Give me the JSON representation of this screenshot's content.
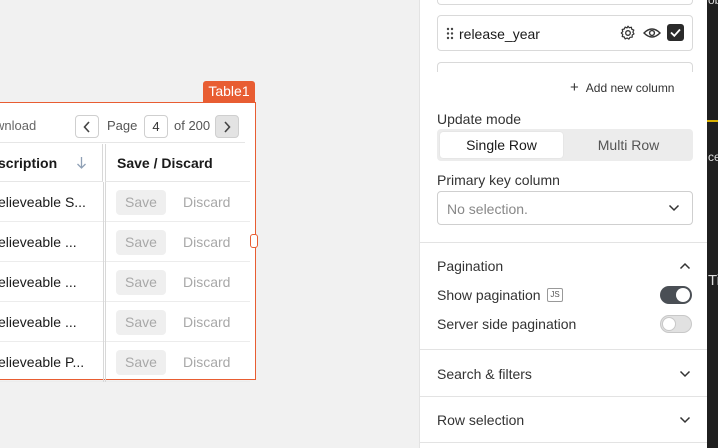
{
  "canvas": {
    "widget_name": "Table1",
    "toolbar": {
      "download_label": "wnload",
      "page_label": "Page",
      "page_value": "4",
      "page_total_label": "of 200"
    },
    "columns": {
      "description_header": "scription",
      "save_discard_header": "Save / Discard"
    },
    "rows": [
      {
        "description": "elieveable S..."
      },
      {
        "description": "elieveable ..."
      },
      {
        "description": "elieveable ..."
      },
      {
        "description": "elieveable ..."
      },
      {
        "description": "elieveable P..."
      }
    ],
    "save_label": "Save",
    "discard_label": "Discard"
  },
  "right_strip": {
    "top_text": "ob",
    "mid_text": "ce",
    "lower_text": "Ti"
  },
  "property_pane": {
    "column_item": {
      "name": "release_year"
    },
    "add_column_label": "Add new column",
    "update_mode": {
      "label": "Update mode",
      "options": [
        "Single Row",
        "Multi Row"
      ],
      "selected": "Single Row"
    },
    "primary_key": {
      "label": "Primary key column",
      "placeholder": "No selection."
    },
    "pagination": {
      "title": "Pagination",
      "show_pagination_label": "Show pagination",
      "js_badge": "JS",
      "show_pagination_on": true,
      "server_side_label": "Server side pagination",
      "server_side_on": false
    },
    "search_filters_title": "Search & filters",
    "row_selection_title": "Row selection"
  }
}
